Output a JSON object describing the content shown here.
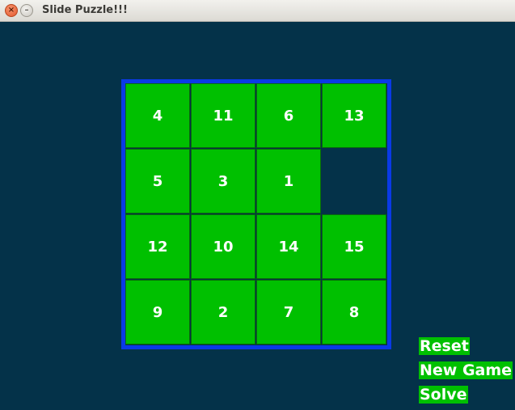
{
  "window": {
    "title": "Slide Puzzle!!!",
    "close_glyph": "×",
    "minimize_glyph": "–"
  },
  "board": {
    "rows": [
      [
        "4",
        "11",
        "6",
        "13"
      ],
      [
        "5",
        "3",
        "1",
        ""
      ],
      [
        "12",
        "10",
        "14",
        "15"
      ],
      [
        "9",
        "2",
        "7",
        "8"
      ]
    ],
    "empty_cell": {
      "row": 1,
      "col": 3
    },
    "colors": {
      "background": "#043249",
      "tile": "#00c000",
      "border": "#0a3ae6",
      "text": "#ffffff"
    }
  },
  "controls": {
    "reset_label": "Reset",
    "new_game_label": "New Game",
    "solve_label": "Solve"
  }
}
